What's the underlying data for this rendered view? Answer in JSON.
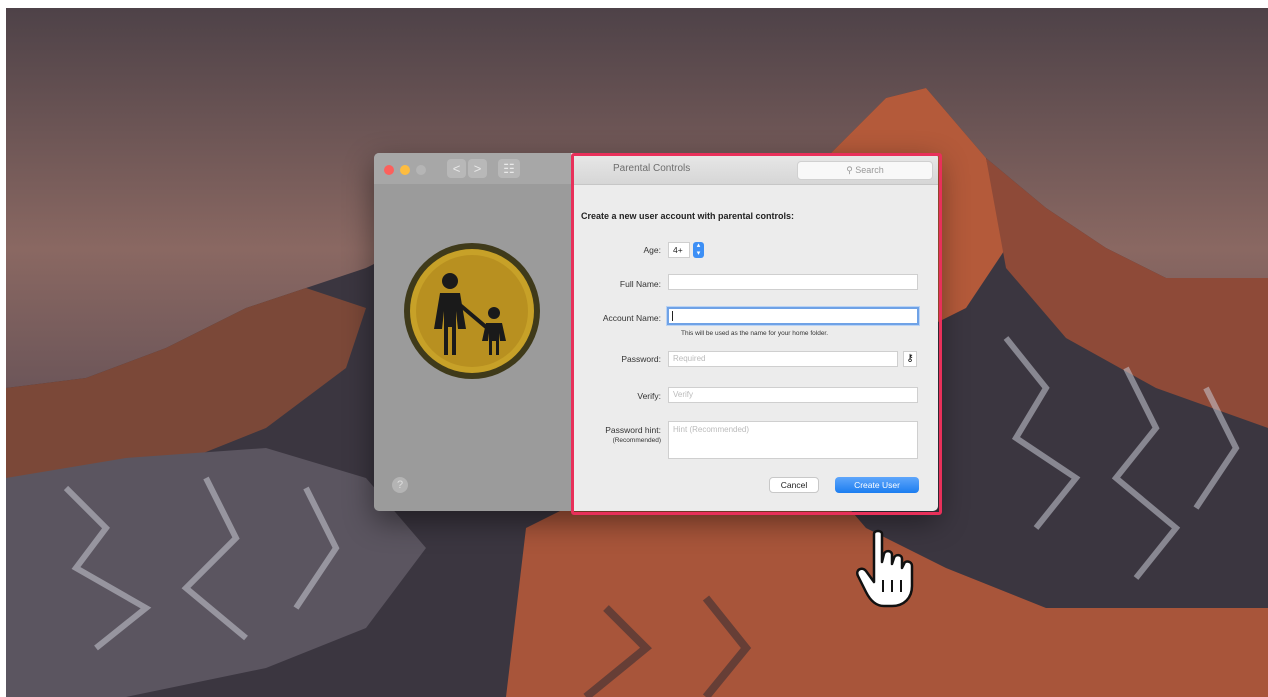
{
  "window": {
    "title": "Parental Controls",
    "search_placeholder": "Search",
    "nav_back": "<",
    "nav_forward": ">",
    "grid": "☷",
    "help": "?"
  },
  "form": {
    "heading": "Create a new user account with parental controls:",
    "age_label": "Age:",
    "age_value": "4+",
    "full_name_label": "Full Name:",
    "full_name_value": "",
    "account_name_label": "Account Name:",
    "account_name_value": "",
    "account_name_hint": "This will be used as the name for your home folder.",
    "password_label": "Password:",
    "password_placeholder": "Required",
    "verify_label": "Verify:",
    "verify_placeholder": "Verify",
    "hint_label": "Password hint:",
    "hint_sublabel": "(Recommended)",
    "hint_placeholder": "Hint (Recommended)",
    "cancel_label": "Cancel",
    "create_label": "Create User"
  },
  "colors": {
    "accent": "#1c7df0",
    "highlight": "#e8305a",
    "close": "#fc605c",
    "minimize": "#fdbc40",
    "zoom": "#b5b5b5"
  }
}
